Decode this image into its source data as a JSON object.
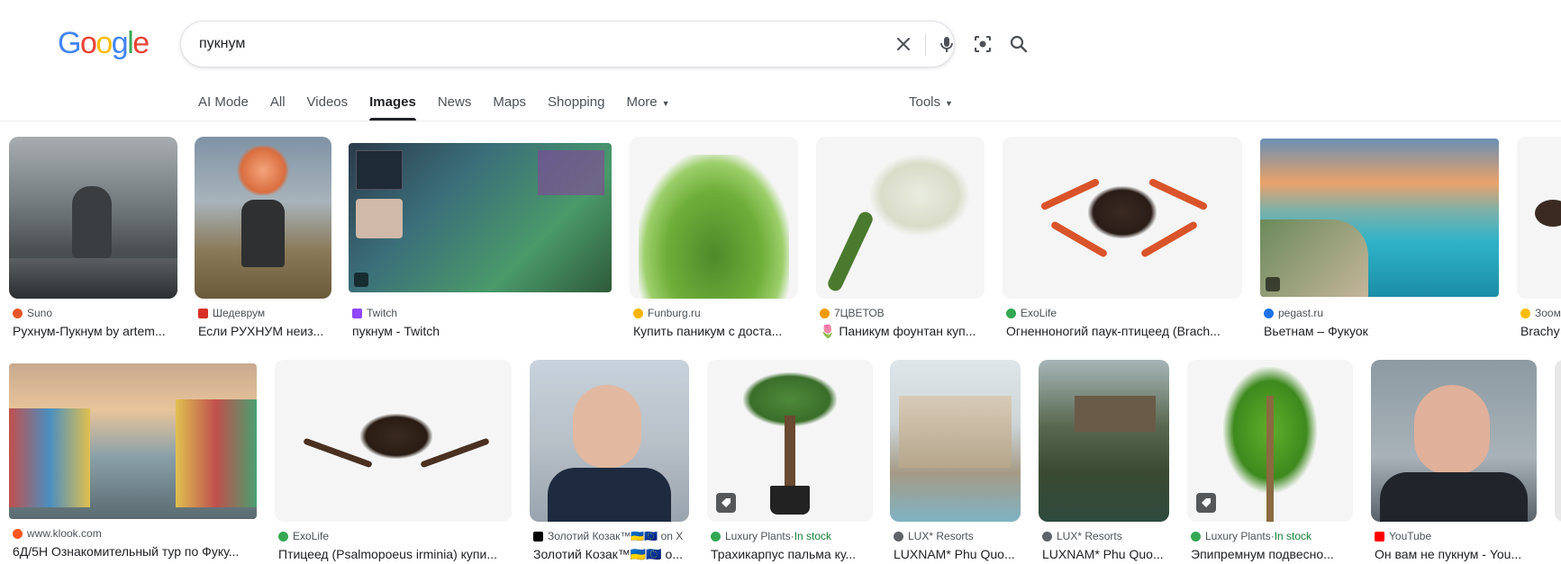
{
  "logo": {
    "letters": [
      "G",
      "o",
      "o",
      "g",
      "l",
      "e"
    ],
    "colors": [
      "#4285F4",
      "#EA4335",
      "#FBBC05",
      "#4285F4",
      "#34A853",
      "#EA4335"
    ]
  },
  "search": {
    "query": "пукнум"
  },
  "tabs": [
    {
      "label": "AI Mode",
      "active": false
    },
    {
      "label": "All",
      "active": false
    },
    {
      "label": "Videos",
      "active": false
    },
    {
      "label": "Images",
      "active": true
    },
    {
      "label": "News",
      "active": false
    },
    {
      "label": "Maps",
      "active": false
    },
    {
      "label": "Shopping",
      "active": false
    },
    {
      "label": "More",
      "active": false
    }
  ],
  "tools_label": "Tools",
  "row1": [
    {
      "source": "Suno",
      "caption": "Рухнум-Пукнум by artem...",
      "icon": "suno-favicon",
      "color": "#e8572a"
    },
    {
      "source": "Шедеврум",
      "caption": "Если РУХНУМ неиз...",
      "icon": "shedevrum-favicon",
      "color": "#d93025"
    },
    {
      "source": "Twitch",
      "caption": "пукнум - Twitch",
      "icon": "twitch-favicon",
      "color": "#9146ff"
    },
    {
      "source": "Funburg.ru",
      "caption": "Купить паникум с доста...",
      "icon": "funburg-favicon",
      "color": "#f4b400"
    },
    {
      "source": "7ЦВЕТОВ",
      "caption": "🌷 Паникум фоунтан куп...",
      "icon": "flower-favicon",
      "color": "#f29900"
    },
    {
      "source": "ExoLife",
      "caption": "Огненноногий паук-птицеед (Brach...",
      "icon": "exolife-favicon",
      "color": "#34a853"
    },
    {
      "source": "pegast.ru",
      "caption": "Вьетнам – Фукуок",
      "icon": "pegast-favicon",
      "color": "#1a73e8"
    },
    {
      "source": "Зоом",
      "caption": "Brachy",
      "icon": "zoom-favicon",
      "color": "#fbbc05"
    }
  ],
  "row2": [
    {
      "source": "www.klook.com",
      "caption": "6Д/5Н Ознакомительный тур по Фуку...",
      "icon": "klook-favicon",
      "color": "#ff5722"
    },
    {
      "source": "ExoLife",
      "caption": "Птицеед (Psalmopoeus irminia) купи...",
      "icon": "exolife-favicon",
      "color": "#34a853"
    },
    {
      "source": "Золотий Козак™🇺🇦🇪🇺 on X",
      "caption": "Золотий Козак™🇺🇦🇪🇺 о...",
      "icon": "x-favicon",
      "color": "#000000"
    },
    {
      "source": "Luxury Plants",
      "stock": "In stock",
      "caption": "Трахикарпус пальма ку...",
      "icon": "luxuryplants-favicon",
      "color": "#34a853"
    },
    {
      "source": "LUX* Resorts",
      "caption": "LUXNAM* Phu Quo...",
      "icon": "lux-favicon",
      "color": "#5f6368"
    },
    {
      "source": "LUX* Resorts",
      "caption": "LUXNAM* Phu Quo...",
      "icon": "lux-favicon",
      "color": "#5f6368"
    },
    {
      "source": "Luxury Plants",
      "stock": "In stock",
      "caption": "Эпипремнум подвесно...",
      "icon": "luxuryplants-favicon",
      "color": "#34a853"
    },
    {
      "source": "YouTube",
      "caption": "Он вам не пукнум - You...",
      "icon": "youtube-favicon",
      "color": "#ff0000"
    }
  ],
  "stock_separator": " · "
}
